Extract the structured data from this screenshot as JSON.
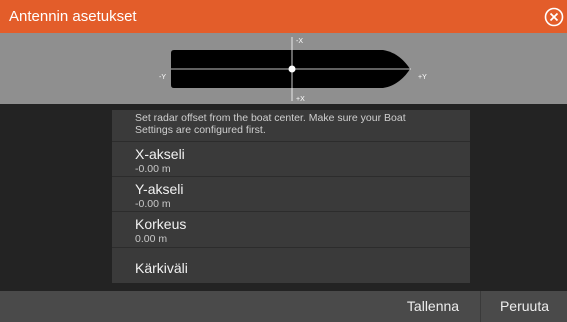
{
  "window": {
    "title": "Antennin asetukset",
    "close_icon": "close-circle-icon"
  },
  "boat_diagram": {
    "axis_labels": {
      "neg_x": "-X",
      "pos_x": "+X",
      "neg_y": "-Y",
      "pos_y": "+Y"
    },
    "colors": {
      "hull": "#000000",
      "marker": "#ffffff",
      "background": "#8f8f8f"
    }
  },
  "dialog": {
    "description_line1": "Set radar offset from the boat center. Make sure your Boat",
    "description_line2": "Settings are configured first.",
    "items": [
      {
        "label": "X-akseli",
        "value": "-0.00 m"
      },
      {
        "label": "Y-akseli",
        "value": "-0.00 m"
      },
      {
        "label": "Korkeus",
        "value": "0.00 m"
      },
      {
        "label": "Kärkiväli"
      }
    ]
  },
  "footer": {
    "save_label": "Tallenna",
    "cancel_label": "Peruuta"
  },
  "colors": {
    "accent": "#e35d2a",
    "background": "#232323",
    "panel": "#3a3a3a",
    "footer": "#4a4a4a"
  }
}
